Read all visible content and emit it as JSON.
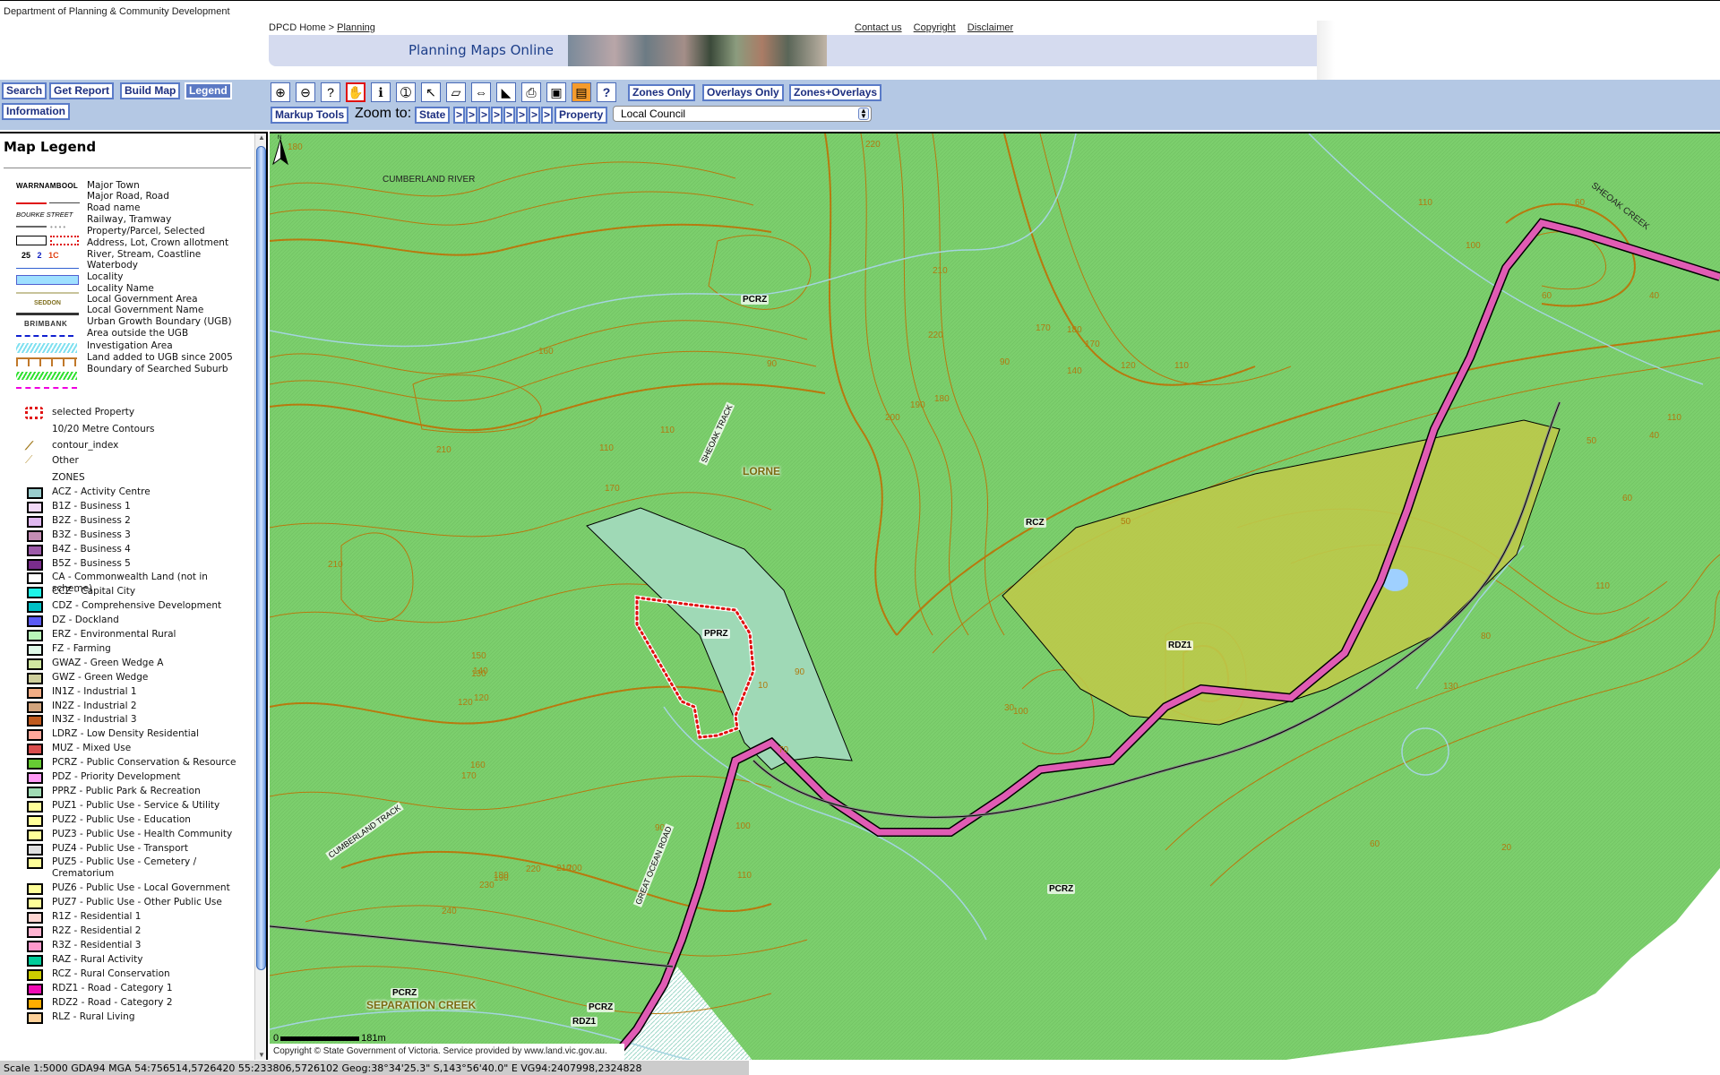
{
  "header": {
    "department": "Department of Planning & Community Development",
    "breadcrumb_home": "DPCD Home >",
    "breadcrumb_link": "Planning",
    "links": [
      "Contact us",
      "Copyright",
      "Disclaimer"
    ],
    "banner_title": "Planning Maps Online"
  },
  "nav": {
    "search": "Search",
    "get_report": "Get Report",
    "build_map": "Build Map",
    "legend": "Legend",
    "information": "Information"
  },
  "toolbar": {
    "tools": [
      {
        "name": "zoom-in-icon",
        "glyph": "⊕"
      },
      {
        "name": "zoom-out-icon",
        "glyph": "⊖"
      },
      {
        "name": "zoom-query-icon",
        "glyph": "?"
      },
      {
        "name": "pan-hand-icon",
        "glyph": "✋"
      },
      {
        "name": "info-icon",
        "glyph": "ℹ"
      },
      {
        "name": "identify-icon",
        "glyph": "➀"
      },
      {
        "name": "select-arrow-icon",
        "glyph": "↖"
      },
      {
        "name": "eraser-icon",
        "glyph": "▱"
      },
      {
        "name": "measure-icon",
        "glyph": "⇔"
      },
      {
        "name": "area-measure-icon",
        "glyph": "◣"
      },
      {
        "name": "print-icon",
        "glyph": "⎙"
      },
      {
        "name": "save-icon",
        "glyph": "▣"
      },
      {
        "name": "save-as-icon",
        "glyph": "▤"
      },
      {
        "name": "help-icon",
        "glyph": "?"
      }
    ],
    "zones_only": "Zones Only",
    "overlays_only": "Overlays Only",
    "zones_overlays": "Zones+Overlays",
    "markup_tools": "Markup Tools",
    "zoom_to": "Zoom to:",
    "state": "State",
    "step": ">",
    "property": "Property",
    "council_select": "Local Council"
  },
  "legend": {
    "title": "Map Legend",
    "symbols": [
      {
        "sample": "WARRNAMBOOL",
        "label": "Major Town"
      },
      {
        "sample": "",
        "label": "Major Road, Road"
      },
      {
        "sample": "BOURKE STREET",
        "label": "Road name"
      },
      {
        "sample": "",
        "label": "Railway, Tramway"
      },
      {
        "sample": "",
        "label": "Property/Parcel, Selected"
      },
      {
        "sample": "25  2  1C",
        "label": "Address, Lot, Crown allotment"
      },
      {
        "sample": "",
        "label": "River, Stream, Coastline"
      },
      {
        "sample": "",
        "label": "Waterbody"
      },
      {
        "sample": "",
        "label": "Locality"
      },
      {
        "sample": "SEDDON",
        "label": "Locality Name"
      },
      {
        "sample": "",
        "label": "Local Government Area"
      },
      {
        "sample": "BRIMBANK",
        "label": "Local Government Name"
      },
      {
        "sample": "",
        "label": "Urban Growth Boundary (UGB)"
      },
      {
        "sample": "",
        "label": "Area outside the UGB"
      },
      {
        "sample": "",
        "label": "Investigation Area"
      },
      {
        "sample": "",
        "label": "Land added to UGB since 2005"
      },
      {
        "sample": "",
        "label": "Boundary of Searched Suburb"
      }
    ],
    "selected_property": "selected Property",
    "contours_heading": "10/20 Metre Contours",
    "contour_index": "contour_index",
    "contour_other": "Other",
    "zones_heading": "ZONES",
    "zones": [
      {
        "label": "ACZ - Activity Centre",
        "color": "#99cccc"
      },
      {
        "label": "B1Z - Business 1",
        "color": "#f2d9f7"
      },
      {
        "label": "B2Z - Business 2",
        "color": "#e0b8f0"
      },
      {
        "label": "B3Z - Business 3",
        "color": "#c48db4"
      },
      {
        "label": "B4Z - Business 4",
        "color": "#9c5aa8"
      },
      {
        "label": "B5Z - Business 5",
        "color": "#7a2d8c"
      },
      {
        "label": "CA - Commonwealth Land (not in scheme)",
        "color": "#ffffff"
      },
      {
        "label": "CCZ - Capital City",
        "color": "#1ef5e8"
      },
      {
        "label": "CDZ - Comprehensive Development",
        "color": "#00bfc4"
      },
      {
        "label": "DZ - Dockland",
        "color": "#5a5af5"
      },
      {
        "label": "ERZ - Environmental Rural",
        "color": "#b8f5b8"
      },
      {
        "label": "FZ - Farming",
        "color": "#e0fae8"
      },
      {
        "label": "GWAZ - Green Wedge A",
        "color": "#cfe6a0"
      },
      {
        "label": "GWZ - Green Wedge",
        "color": "#cfcf9c"
      },
      {
        "label": "IN1Z - Industrial 1",
        "color": "#f2ad85"
      },
      {
        "label": "IN2Z - Industrial 2",
        "color": "#d2a47d"
      },
      {
        "label": "IN3Z - Industrial 3",
        "color": "#c05a1e"
      },
      {
        "label": "LDRZ - Low Density Residential",
        "color": "#ffa89a"
      },
      {
        "label": "MUZ - Mixed Use",
        "color": "#d94d4d"
      },
      {
        "label": "PCRZ - Public Conservation & Resource",
        "color": "#66cc33"
      },
      {
        "label": "PDZ - Priority Development",
        "color": "#ff99f5"
      },
      {
        "label": "PPRZ - Public Park & Recreation",
        "color": "#a0dbb4"
      },
      {
        "label": "PUZ1 - Public Use - Service & Utility",
        "color": "#ffff99"
      },
      {
        "label": "PUZ2 - Public Use - Education",
        "color": "#ffff99"
      },
      {
        "label": "PUZ3 - Public Use - Health Community",
        "color": "#ffff99"
      },
      {
        "label": "PUZ4 - Public Use - Transport",
        "color": "#e0e0e0"
      },
      {
        "label": "PUZ5 - Public Use - Cemetery / Crematorium",
        "color": "#ffff99"
      },
      {
        "label": "PUZ6 - Public Use - Local Government",
        "color": "#ffff99"
      },
      {
        "label": "PUZ7 - Public Use - Other Public Use",
        "color": "#ffff99"
      },
      {
        "label": "R1Z - Residential 1",
        "color": "#ffd6d2"
      },
      {
        "label": "R2Z - Residential 2",
        "color": "#ffb3d1"
      },
      {
        "label": "R3Z - Residential 3",
        "color": "#ff99cc"
      },
      {
        "label": "RAZ - Rural Activity",
        "color": "#00cc99"
      },
      {
        "label": "RCZ - Rural Conservation",
        "color": "#cccc00"
      },
      {
        "label": "RDZ1 - Road - Category 1",
        "color": "#f00ab4"
      },
      {
        "label": "RDZ2 - Road - Category 2",
        "color": "#ffad00"
      },
      {
        "label": "RLZ - Rural Living",
        "color": "#ffd199"
      }
    ]
  },
  "map": {
    "colors": {
      "pcrz": "#7ccf6d",
      "pprz": "#9fd9b6",
      "rcz": "#bcc94a",
      "rdz1": "#e05cb4",
      "contour": "#b8790e",
      "stream": "#a4d4e0",
      "waterbody": "#9fd0ff",
      "selected": "#e01010"
    },
    "zone_labels": [
      {
        "id": "pcrz-north",
        "text": "PCRZ"
      },
      {
        "id": "pprz",
        "text": "PPRZ"
      },
      {
        "id": "rcz",
        "text": "RCZ"
      },
      {
        "id": "rdz1-east",
        "text": "RDZ1"
      },
      {
        "id": "pcrz-south",
        "text": "PCRZ"
      },
      {
        "id": "pcrz-sep",
        "text": "PCRZ"
      },
      {
        "id": "pcrz-road",
        "text": "PCRZ"
      },
      {
        "id": "rdz1-south",
        "text": "RDZ1"
      }
    ],
    "place_names": {
      "lorne": "LORNE",
      "separation_creek": "SEPARATION CREEK"
    },
    "streets": {
      "sheoak_track": "SHEOAK TRACK",
      "cumberland_track": "CUMBERLAND TRACK",
      "great_ocean_road": "GREAT OCEAN ROAD"
    },
    "waterways": {
      "cumberland_river": "CUMBERLAND RIVER",
      "sheoak_creek": "SHEOAK CREEK"
    },
    "contour_values": [
      "180",
      "220",
      "210",
      "220",
      "160",
      "170",
      "180",
      "140",
      "120",
      "110",
      "90",
      "170",
      "200",
      "190",
      "180",
      "110",
      "210",
      "170",
      "90",
      "60",
      "40",
      "50",
      "50",
      "210",
      "110",
      "120",
      "130",
      "140",
      "150",
      "120",
      "90",
      "100",
      "110",
      "100",
      "110",
      "60",
      "160",
      "170",
      "180",
      "190",
      "200",
      "210",
      "220",
      "230",
      "240",
      "110",
      "60",
      "40",
      "30",
      "20",
      "10",
      "70",
      "90",
      "100",
      "110",
      "80",
      "130",
      "60"
    ],
    "scale_start": "0",
    "scale_end": "181m",
    "copyright": "Copyright © State Government of Victoria. Service provided by www.land.vic.gov.au."
  },
  "status": {
    "text": "Scale 1:5000 GDA94 MGA 54:756514,5726420 55:233806,5726102 Geog:38°34'25.3\" S,143°56'40.0\" E VG94:2407998,2324828"
  }
}
